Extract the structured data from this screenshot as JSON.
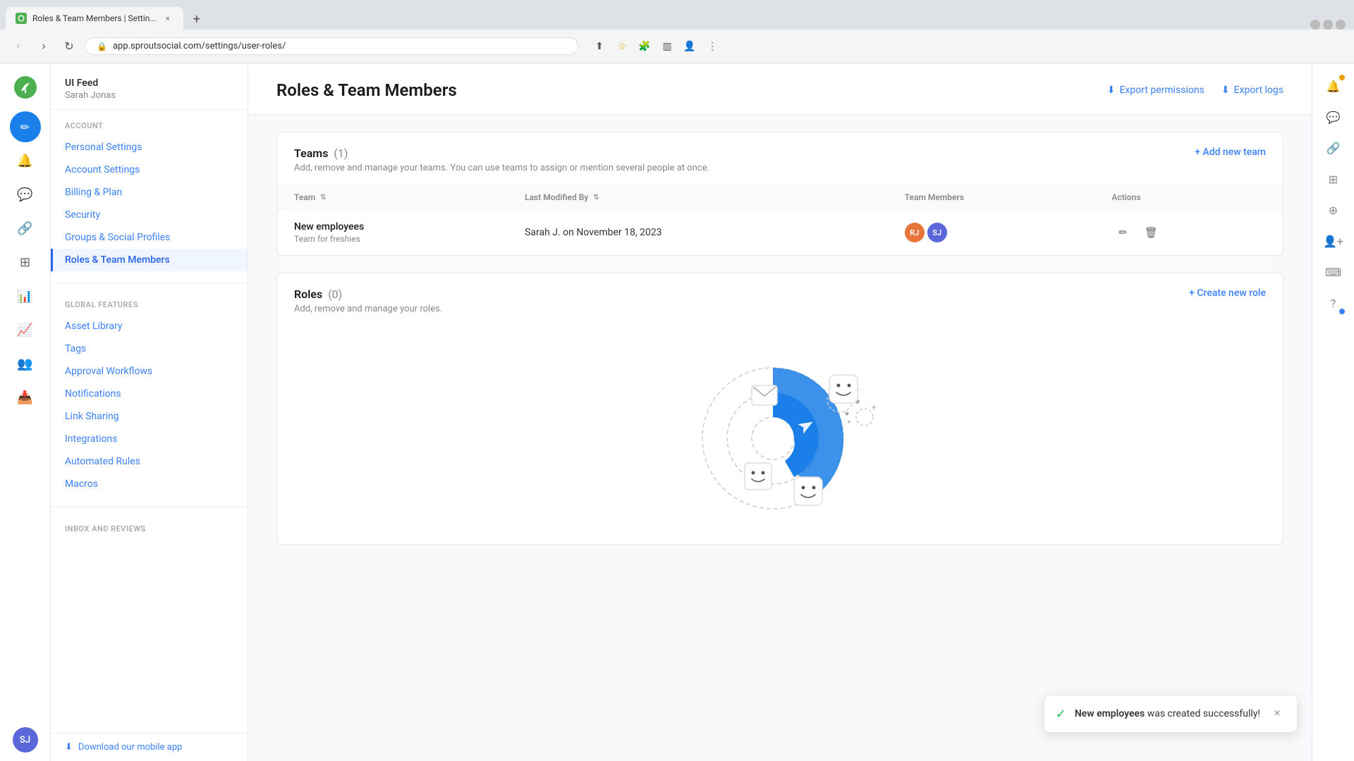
{
  "browser": {
    "tab_title": "Roles & Team Members | Settin...",
    "tab_close": "×",
    "tab_new": "+",
    "nav_back": "‹",
    "nav_forward": "›",
    "nav_reload": "↻",
    "address": "app.sproutsocial.com/settings/user-roles/",
    "window_min": "—",
    "window_max": "❐",
    "window_close": "×"
  },
  "sidebar": {
    "app_name": "UI Feed",
    "user_name": "Sarah Jonas",
    "account_section": "Account",
    "items_account": [
      {
        "label": "Personal Settings",
        "active": false
      },
      {
        "label": "Account Settings",
        "active": false
      },
      {
        "label": "Billing & Plan",
        "active": false
      },
      {
        "label": "Security",
        "active": false
      },
      {
        "label": "Groups & Social Profiles",
        "active": false
      },
      {
        "label": "Roles & Team Members",
        "active": true
      }
    ],
    "global_section": "Global Features",
    "items_global": [
      {
        "label": "Asset Library",
        "active": false
      },
      {
        "label": "Tags",
        "active": false
      },
      {
        "label": "Approval Workflows",
        "active": false
      },
      {
        "label": "Notifications",
        "active": false
      },
      {
        "label": "Link Sharing",
        "active": false
      },
      {
        "label": "Integrations",
        "active": false
      },
      {
        "label": "Automated Rules",
        "active": false
      },
      {
        "label": "Macros",
        "active": false
      }
    ],
    "inbox_section": "Inbox and Reviews",
    "download_label": "Download our mobile app"
  },
  "page": {
    "title": "Roles & Team Members",
    "export_permissions": "Export permissions",
    "export_logs": "Export logs"
  },
  "teams_card": {
    "title": "Teams",
    "count": "(1)",
    "subtitle": "Add, remove and manage your teams. You can use teams to assign or mention several people at once.",
    "add_action": "+ Add new team",
    "col_team": "Team",
    "col_last_modified": "Last Modified By",
    "col_members": "Team Members",
    "col_actions": "Actions",
    "rows": [
      {
        "name": "New employees",
        "description": "Team for freshies",
        "last_modified": "Sarah J. on November 18, 2023",
        "members": [
          "RJ",
          "SJ"
        ]
      }
    ]
  },
  "roles_card": {
    "title": "Roles",
    "count": "(0)",
    "subtitle": "Add, remove and manage your roles.",
    "add_action": "+ Create new role"
  },
  "toast": {
    "text_bold": "New employees",
    "text_rest": " was created successfully!",
    "close": "×"
  },
  "icons": {
    "sprout": "🌱",
    "bell": "🔔",
    "message": "💬",
    "link": "🔗",
    "grid": "⊞",
    "plus_circle": "⊕",
    "user_plus": "👤",
    "keyboard": "⌨",
    "question": "?",
    "compose": "✏",
    "search": "🔍",
    "analytics": "📊",
    "bar_chart": "📈",
    "send": "📨",
    "inbox": "📥",
    "settings": "⚙",
    "edit": "✏",
    "delete": "🗑",
    "download": "⬇",
    "check_circle": "✓"
  }
}
